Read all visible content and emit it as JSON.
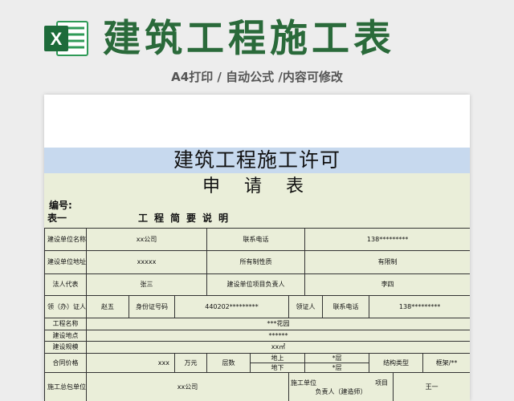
{
  "banner": {
    "logo_letter": "X",
    "title": "建筑工程施工表",
    "subtitle": "A4打印 / 自动公式 /内容可修改",
    "colors": {
      "title": "#2a6a3a",
      "logo_dark": "#1d6b3a",
      "logo_light": "#2f9a57"
    }
  },
  "sheet": {
    "head": "建筑工程施工许可",
    "subtitle": "申请表",
    "bianhao_label": "编号:",
    "table_label": "表一",
    "table_title": "工程简要说明",
    "colors": {
      "head_bg": "#c7d9ee",
      "body_bg": "#eaeed9"
    }
  },
  "rows": {
    "r1": {
      "label1": "建设单位名称",
      "value1": "xx公司",
      "label2": "联系电话",
      "value2": "138*********"
    },
    "r2": {
      "label1": "建设单位地址",
      "value1": "xxxxx",
      "label2": "所有制性质",
      "value2": "有限制"
    },
    "r3": {
      "label1": "法人代表",
      "value1": "张三",
      "label2": "建设单位项目负责人",
      "value2": "李四"
    },
    "r4": {
      "label1": "领（办）证人",
      "value1": "赵五",
      "label2": "身份证号码",
      "value2": "440202*********",
      "label3": "领证人",
      "label4": "联系电话",
      "value3": "138*********"
    },
    "r5": {
      "label": "工程名称",
      "value": "***花园"
    },
    "r6": {
      "label": "建设地点",
      "value": "******"
    },
    "r7": {
      "label": "建设规模",
      "value": "xx㎡"
    },
    "r8": {
      "label": "合同价格",
      "value": "xxx",
      "unit": "万元",
      "floors_label": "层数",
      "above_label": "地上",
      "above_value": "*层",
      "below_label": "地下",
      "below_value": "*层",
      "structure_label": "结构类型",
      "structure_value": "框架/**"
    },
    "r9": {
      "label": "施工总包单位",
      "value": "xx公司",
      "manager_label_1": "施工单位",
      "manager_label_2": "项目",
      "manager_label_3": "负责人（建造师）",
      "manager_value": "王一"
    }
  }
}
